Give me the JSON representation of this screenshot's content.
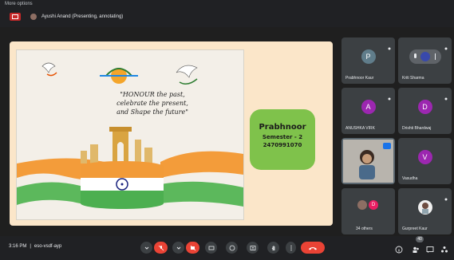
{
  "app": {
    "more_options_label": "More options",
    "presenter_label": "Ayushi Anand (Presenting, annotating)"
  },
  "slide": {
    "quote_line1": "\"HONOUR the past,",
    "quote_line2": "celebrate the present,",
    "quote_line3": "and Shape the future\"",
    "name": "Prabhnoor",
    "semester": "Semester - 2",
    "roll": "2470991070",
    "colors": {
      "bg": "#fbe6c9",
      "card": "#7fc24b"
    }
  },
  "participants": [
    {
      "label": "Prabhnoor Kaur",
      "initial": "P",
      "color": "#607d8b"
    },
    {
      "label": "Kriti Sharma",
      "initial": "",
      "color": "#5f6368"
    },
    {
      "label": "ANUSHKA VIRK",
      "initial": "A",
      "color": "#9c27b0"
    },
    {
      "label": "Drishti Bhardwaj",
      "initial": "D",
      "color": "#9c27b0"
    },
    {
      "label": "Vasudha",
      "initial": "V",
      "color": "#9c27b0"
    },
    {
      "label": "34 others",
      "initial": "D",
      "color": "#e91e63"
    },
    {
      "label": "Gurpreet Kaur",
      "initial": "",
      "color": "#5f6368"
    }
  ],
  "bottom": {
    "time": "3:16 PM",
    "separator": "|",
    "meeting_code": "eso-vsdf-ayp",
    "participants_count": "40"
  }
}
